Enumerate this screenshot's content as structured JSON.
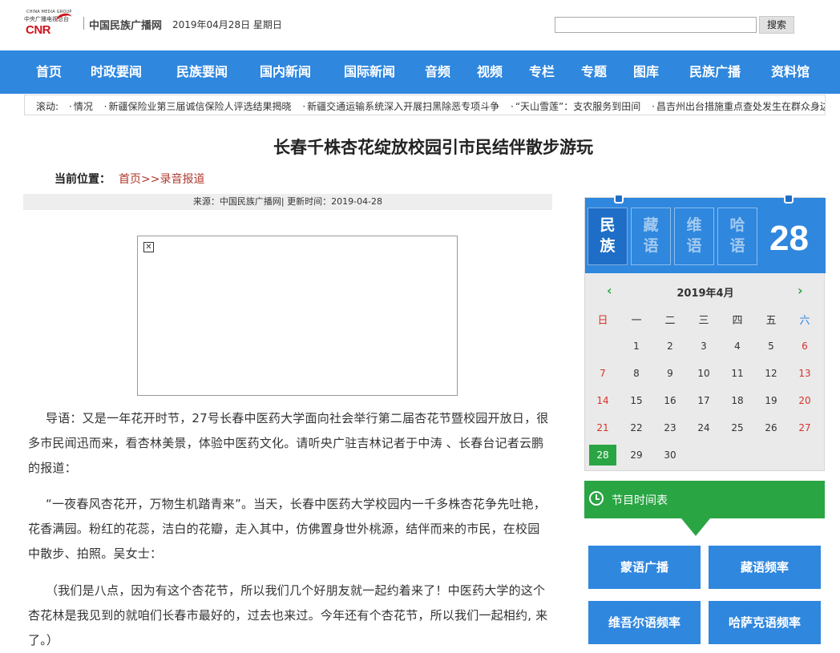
{
  "header": {
    "logo_group": "CHINA MEDIA GROUP",
    "logo_cmg": "中央广播电视总台",
    "logo_brand": "CNR",
    "site_name": "中国民族广播网",
    "date": "2019年04月28日 星期日",
    "search_placeholder": "",
    "search_button": "搜索"
  },
  "nav": [
    "首页",
    "时政要闻",
    "民族要闻",
    "国内新闻",
    "国际新闻",
    "音频",
    "视频",
    "专栏",
    "专题",
    "图库",
    "民族广播",
    "资料馆"
  ],
  "ticker": {
    "label": "滚动:",
    "items": [
      "情况",
      "新疆保险业第三届诚信保险人评选结果揭晓",
      "新疆交通运输系统深入开展扫黑除恶专项斗争",
      "“天山雪莲”：支农服务到田间",
      "昌吉州出台措施重点查处发生在群众身边的"
    ]
  },
  "article": {
    "title": "长春千株杏花绽放校园引市民结伴散步游玩",
    "crumb_label": "当前位置：",
    "crumb": "首页>>录音报道",
    "meta": "来源：中国民族广播网| 更新时间：2019-04-28",
    "paragraphs": [
      "导语：又是一年花开时节，27号长春中医药大学面向社会举行第二届杏花节暨校园开放日，很多市民闻迅而来，看杏林美景，体验中医药文化。请听央广驻吉林记者于中涛 、长春台记者云鹏的报道：",
      "“一夜春风杏花开，万物生机踏青来”。当天，长春中医药大学校园内一千多株杏花争先吐艳，花香满园。粉红的花蕊，洁白的花瓣，走入其中，仿佛置身世外桃源，结伴而来的市民，在校园中散步、拍照。吴女士：",
      "（我们是八点，因为有这个杏花节，所以我们几个好朋友就一起约着来了！中医药大学的这个杏花林是我见到的就咱们长春市最好的，过去也来过。今年还有个杏花节，所以我们一起相约, 来了。）"
    ]
  },
  "calendar": {
    "languages": [
      "民\n族",
      "藏\n语",
      "维\n语",
      "哈\n语"
    ],
    "big_day": "28",
    "month": "2019年4月",
    "prev": "‹",
    "next": "›",
    "weekdays": [
      "日",
      "一",
      "二",
      "三",
      "四",
      "五",
      "六"
    ],
    "first_weekday": 1,
    "days_in_month": 30,
    "today": 28
  },
  "schedule": {
    "label": "节目时间表"
  },
  "frequencies": [
    "蒙语广播",
    "藏语频率",
    "维吾尔语频率",
    "哈萨克语频率"
  ]
}
